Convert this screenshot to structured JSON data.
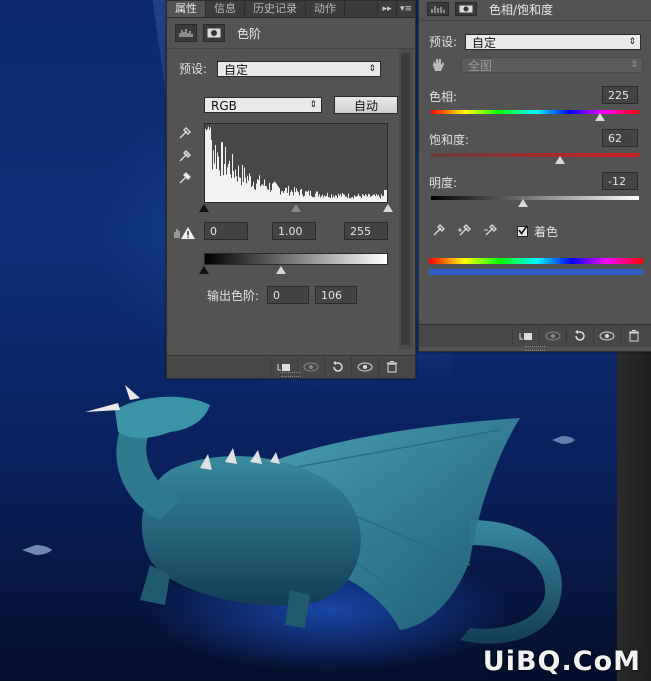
{
  "levels_panel": {
    "tabs": [
      {
        "label": "属性",
        "active": true
      },
      {
        "label": "信息",
        "active": false
      },
      {
        "label": "历史记录",
        "active": false
      },
      {
        "label": "动作",
        "active": false
      }
    ],
    "title": "色阶",
    "preset_label": "预设:",
    "preset_value": "自定",
    "channel_value": "RGB",
    "auto_label": "自动",
    "input_black": "0",
    "input_gamma": "1.00",
    "input_white": "255",
    "output_label": "输出色阶:",
    "output_black": "0",
    "output_white": "106",
    "input_black_fraction": 0.0,
    "input_gamma_fraction": 0.5,
    "input_white_fraction": 1.0,
    "output_black_fraction": 0.0,
    "output_white_fraction": 0.416
  },
  "hue_panel": {
    "title": "色相/饱和度",
    "preset_label": "预设:",
    "preset_value": "自定",
    "range_value": "全图",
    "hue_label": "色相:",
    "hue_value": "225",
    "hue_fraction": 0.8125,
    "saturation_label": "饱和度:",
    "saturation_value": "62",
    "saturation_fraction": 0.62,
    "lightness_label": "明度:",
    "lightness_value": "-12",
    "lightness_fraction": 0.44,
    "colorize_label": "着色",
    "colorize_checked": true
  },
  "colors": {
    "panel_bg": "#535353",
    "tab_bg": "#3c3c3c",
    "field_bg": "#434343",
    "accent_blue": "#2f5fc4"
  },
  "icons": [
    "histogram-icon",
    "mask-icon",
    "eyedropper-icon",
    "warning-icon",
    "clip-to-layer-icon",
    "view-previous-icon",
    "reset-icon",
    "visibility-eye-icon",
    "trash-icon",
    "hand-target-icon"
  ],
  "watermark": "UiBQ.CoM"
}
